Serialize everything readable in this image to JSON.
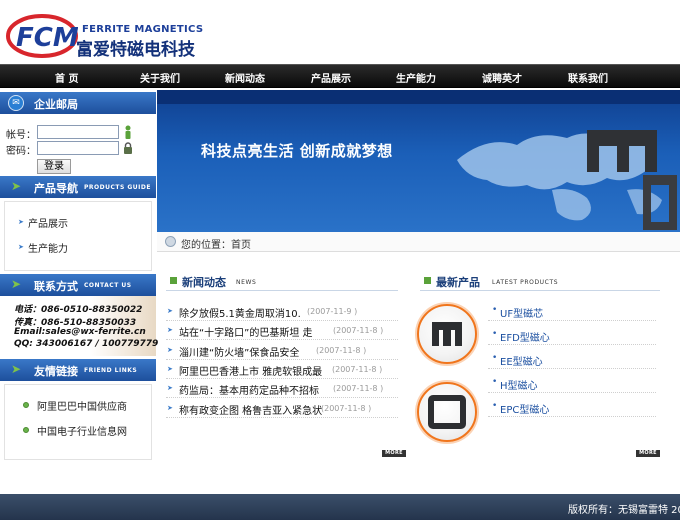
{
  "brand": {
    "logo_letters": "FCM",
    "name_en": "FERRITE MAGNETICS",
    "name_cn": "富爱特磁电科技"
  },
  "nav": {
    "items": [
      {
        "label": "首    页"
      },
      {
        "label": "关于我们"
      },
      {
        "label": "新闻动态"
      },
      {
        "label": "产品展示"
      },
      {
        "label": "生产能力"
      },
      {
        "label": "诚聘英才"
      },
      {
        "label": "联系我们"
      }
    ]
  },
  "sidebar": {
    "email": {
      "title": "企业邮局",
      "account_label": "帐号：",
      "account_value": "",
      "password_label": "密码：",
      "password_value": "",
      "login_label": "登录"
    },
    "products_nav": {
      "title": "产品导航",
      "title_en": "PRODUCTS GUIDE",
      "items": [
        {
          "label": "产品展示"
        },
        {
          "label": "生产能力"
        }
      ]
    },
    "contact": {
      "title": "联系方式",
      "title_en": "CONTACT US",
      "lines": [
        "电话：086-0510-88350022",
        "传真：086-510-88350033",
        "Email:sales@wx-ferrite.cn",
        "QQ:  343006167  /  100779779"
      ]
    },
    "links": {
      "title": "友情链接",
      "title_en": "FRIEND LINKS",
      "items": [
        {
          "label": "阿里巴巴中国供应商"
        },
        {
          "label": "中国电子行业信息网"
        }
      ]
    }
  },
  "banner": {
    "slogan": "科技点亮生活  创新成就梦想"
  },
  "location": {
    "text": "您的位置：首页"
  },
  "news": {
    "title": "新闻动态",
    "title_en": "NEWS",
    "more_label": "MORE",
    "items": [
      {
        "title": "除夕放假5.1黄金周取消10.",
        "date": "(2007-11-9 )"
      },
      {
        "title": "站在“十字路口”的巴基斯坦 走",
        "date": "(2007-11-8 )"
      },
      {
        "title": "淄川建“防火墙”保食品安全",
        "date": "(2007-11-8 )"
      },
      {
        "title": "阿里巴巴香港上市 雅虎软银成最",
        "date": "(2007-11-8 )"
      },
      {
        "title": "药监局：基本用药定品种不招标",
        "date": "(2007-11-8 )"
      },
      {
        "title": "称有政变企图 格鲁吉亚入紧急状",
        "date": "(2007-11-8 )"
      }
    ]
  },
  "products": {
    "title": "最新产品",
    "title_en": "LATEST PRODUCTS",
    "more_label": "MORE",
    "items": [
      {
        "label": "UF型磁芯"
      },
      {
        "label": "EFD型磁心"
      },
      {
        "label": "EE型磁心"
      },
      {
        "label": "H型磁心"
      },
      {
        "label": "EPC型磁心"
      }
    ]
  },
  "footer": {
    "text": "版权所有：无锡富雷特 20"
  },
  "colors": {
    "nav_bg": "#111111",
    "side_head": "#1d4f9c",
    "banner": "#1b5fb8",
    "accent_orange": "#f0751c",
    "footer_bg": "#2c3d56"
  }
}
